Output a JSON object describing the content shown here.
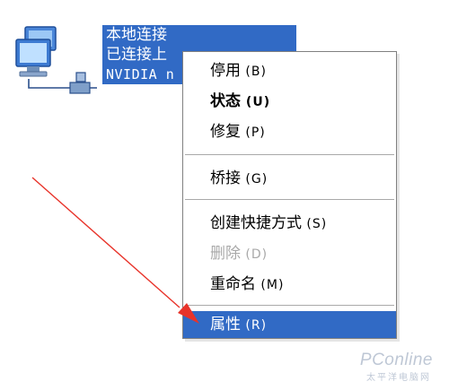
{
  "item_label": {
    "name": "本地连接",
    "status": "已连接上",
    "device": "NVIDIA n"
  },
  "context_menu": {
    "items": [
      {
        "label": "停用",
        "accel": "(B)"
      },
      {
        "label": "状态",
        "accel": "(U)"
      },
      {
        "label": "修复",
        "accel": "(P)"
      },
      {
        "label": "桥接",
        "accel": "(G)"
      },
      {
        "label": "创建快捷方式",
        "accel": "(S)"
      },
      {
        "label": "删除",
        "accel": "(D)"
      },
      {
        "label": "重命名",
        "accel": "(M)"
      },
      {
        "label": "属性",
        "accel": "(R)"
      }
    ]
  },
  "watermark": {
    "text": "PConline",
    "subtext": "太平洋电脑网"
  },
  "colors": {
    "selection": "#316ac5",
    "arrow": "#e8332a",
    "disabled_text": "#a9a9a9"
  }
}
